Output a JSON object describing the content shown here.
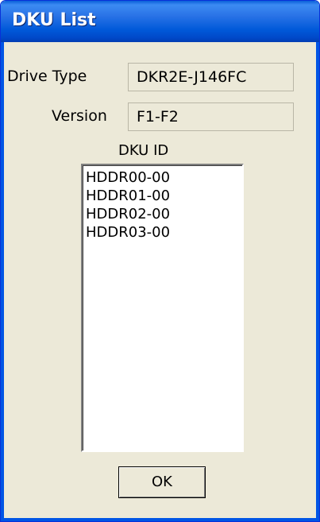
{
  "window": {
    "title": "DKU List"
  },
  "drive_type": {
    "label": "Drive Type",
    "value": "DKR2E-J146FC"
  },
  "version": {
    "label": "Version",
    "value": "F1-F2"
  },
  "dku_id": {
    "label": "DKU ID",
    "items": [
      "HDDR00-00",
      "HDDR01-00",
      "HDDR02-00",
      "HDDR03-00"
    ]
  },
  "buttons": {
    "ok_label": "OK"
  },
  "colors": {
    "titlebar": "#0059d9",
    "window_face": "#ece9d8",
    "list_background": "#ffffff"
  }
}
